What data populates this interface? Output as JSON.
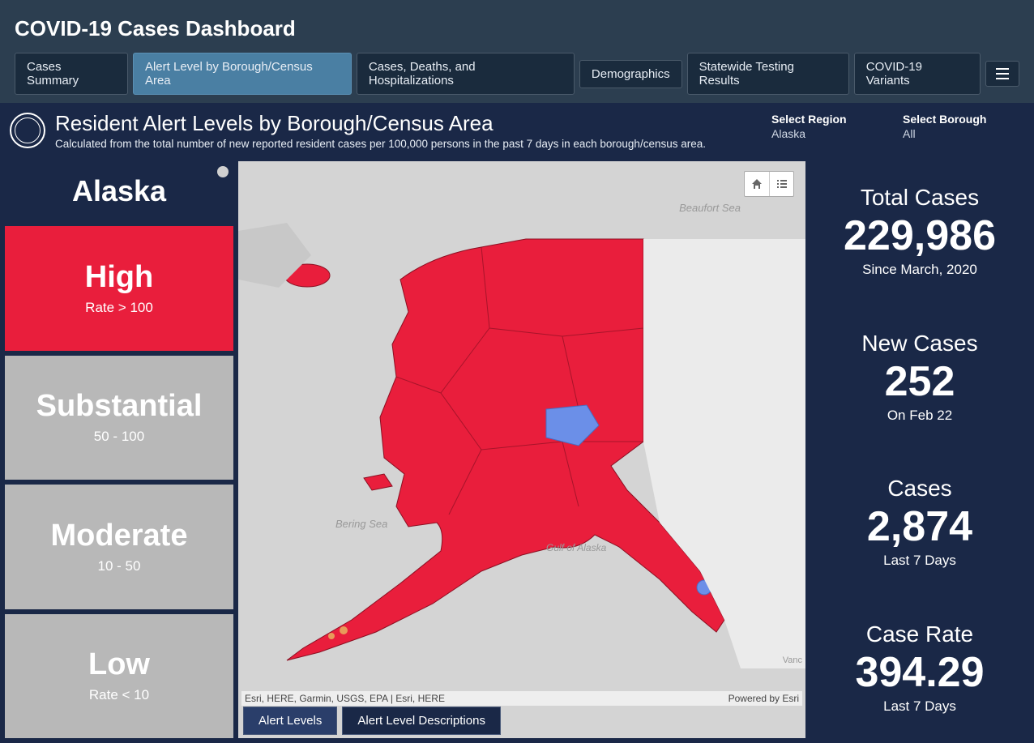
{
  "header": {
    "title": "COVID-19 Cases Dashboard"
  },
  "tabs": [
    {
      "label": "Cases Summary",
      "active": false
    },
    {
      "label": "Alert Level by Borough/Census Area",
      "active": true
    },
    {
      "label": "Cases, Deaths, and Hospitalizations",
      "active": false
    },
    {
      "label": "Demographics",
      "active": false
    },
    {
      "label": "Statewide Testing Results",
      "active": false
    },
    {
      "label": "COVID-19 Variants",
      "active": false
    }
  ],
  "subheader": {
    "title": "Resident Alert Levels by Borough/Census Area",
    "description": "Calculated from the total number of new reported resident cases per 100,000 persons in the past 7 days in each borough/census area."
  },
  "filters": {
    "region": {
      "label": "Select Region",
      "value": "Alaska"
    },
    "borough": {
      "label": "Select Borough",
      "value": "All"
    }
  },
  "left": {
    "region_name": "Alaska",
    "levels": [
      {
        "name": "High",
        "range": "Rate > 100",
        "class": "level-high"
      },
      {
        "name": "Substantial",
        "range": "50 - 100",
        "class": "level-grey"
      },
      {
        "name": "Moderate",
        "range": "10 - 50",
        "class": "level-grey"
      },
      {
        "name": "Low",
        "range": "Rate < 10",
        "class": "level-grey"
      }
    ]
  },
  "map": {
    "water_labels": {
      "beaufort": "Beaufort Sea",
      "bering": "Bering Sea",
      "gulf": "Gulf of Alaska"
    },
    "attribution_left": "Esri, HERE, Garmin, USGS, EPA | Esri, HERE",
    "attribution_right": "Powered by Esri",
    "tabs": [
      {
        "label": "Alert Levels",
        "active": true
      },
      {
        "label": "Alert Level Descriptions",
        "active": false
      }
    ],
    "vanc_label": "Vanc"
  },
  "stats": [
    {
      "title": "Total Cases",
      "value": "229,986",
      "sub": "Since March, 2020"
    },
    {
      "title": "New Cases",
      "value": "252",
      "sub": "On Feb 22"
    },
    {
      "title": "Cases",
      "value": "2,874",
      "sub": "Last 7 Days"
    },
    {
      "title": "Case Rate",
      "value": "394.29",
      "sub": "Last 7 Days"
    }
  ],
  "colors": {
    "high": "#e91e3c",
    "blue_area": "#6b8fe8",
    "orange_area": "#e89b5a"
  }
}
